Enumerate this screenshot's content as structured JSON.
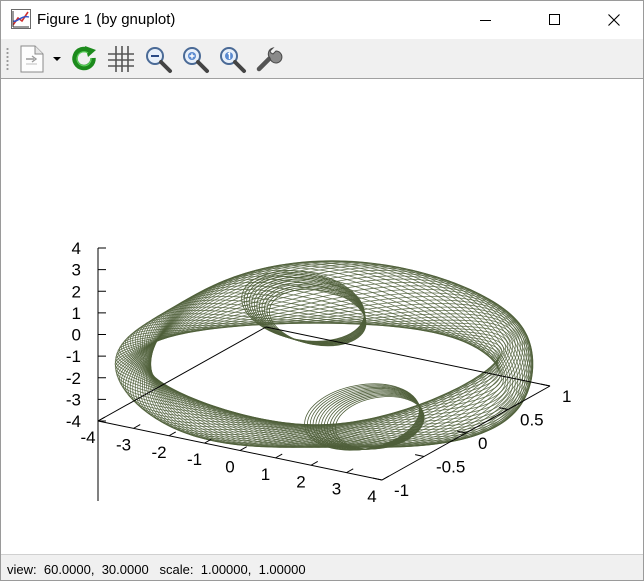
{
  "window": {
    "title": "Figure 1 (by gnuplot)"
  },
  "toolbar": {
    "buttons": [
      {
        "name": "export-button",
        "icon": "document-export-icon"
      },
      {
        "name": "export-dropdown",
        "icon": "triangle-down-icon"
      },
      {
        "name": "replot-button",
        "icon": "refresh-icon"
      },
      {
        "name": "grid-button",
        "icon": "grid-icon"
      },
      {
        "name": "zoom-out-button",
        "icon": "zoom-out-icon"
      },
      {
        "name": "zoom-in-button",
        "icon": "zoom-in-icon"
      },
      {
        "name": "zoom-reset-button",
        "icon": "zoom-reset-icon"
      },
      {
        "name": "config-button",
        "icon": "wrench-icon"
      }
    ]
  },
  "chart_data": {
    "type": "line",
    "title": "",
    "projection": "3d",
    "series_color": "#4f5f3a",
    "x_ticks": [
      "-4",
      "-3",
      "-2",
      "-1",
      "0",
      "1",
      "2",
      "3",
      "4"
    ],
    "y_ticks": [
      "-1",
      "-0.5",
      "0",
      "0.5",
      "1"
    ],
    "z_ticks": [
      "4",
      "3",
      "2",
      "1",
      "0",
      "-1",
      "-2",
      "-3",
      "-4"
    ],
    "xlim": [
      -4,
      4
    ],
    "ylim": [
      -1,
      1
    ],
    "zlim": [
      -4,
      4
    ],
    "grid": false
  },
  "status": {
    "view_label": "view:",
    "view_rot_x": "60.0000,",
    "view_rot_z": "30.0000",
    "scale_label": "scale:",
    "scale_x": "1.00000,",
    "scale_z": "1.00000"
  }
}
